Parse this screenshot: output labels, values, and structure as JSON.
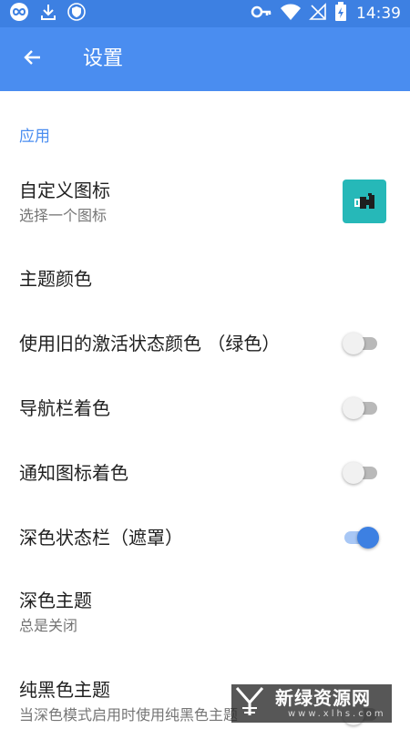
{
  "status_bar": {
    "time": "14:39",
    "left_icons": [
      "infinity-icon",
      "download-icon",
      "shield-icon"
    ],
    "right_icons": [
      "vpn-key-icon",
      "wifi-icon",
      "no-signal-icon",
      "battery-charging-icon"
    ]
  },
  "app_bar": {
    "title": "设置",
    "back_icon": "arrow-left-icon",
    "background": "#4a8df0"
  },
  "section": {
    "header": "应用",
    "header_color": "#4a8df0"
  },
  "settings": [
    {
      "id": "custom-icon",
      "title": "自定义图标",
      "subtitle": "选择一个图标",
      "control": "app-icon",
      "icon_color": "#26b8b8"
    },
    {
      "id": "theme-color",
      "title": "主题颜色",
      "control": "none"
    },
    {
      "id": "old-active-color",
      "title": "使用旧的激活状态颜色 （绿色）",
      "control": "switch",
      "checked": false
    },
    {
      "id": "navbar-tint",
      "title": "导航栏着色",
      "control": "switch",
      "checked": false
    },
    {
      "id": "notif-icon-tint",
      "title": "通知图标着色",
      "control": "switch",
      "checked": false
    },
    {
      "id": "dark-statusbar",
      "title": "深色状态栏（遮罩）",
      "control": "switch",
      "checked": true
    },
    {
      "id": "dark-theme",
      "title": "深色主题",
      "subtitle": "总是关闭",
      "control": "none"
    },
    {
      "id": "black-theme",
      "title": "纯黑色主题",
      "subtitle": "当深色模式启用时使用纯黑色主题",
      "control": "switch",
      "checked": false
    }
  ],
  "watermark": {
    "text": "新绿资源网",
    "url": "www.xlhs.com"
  }
}
